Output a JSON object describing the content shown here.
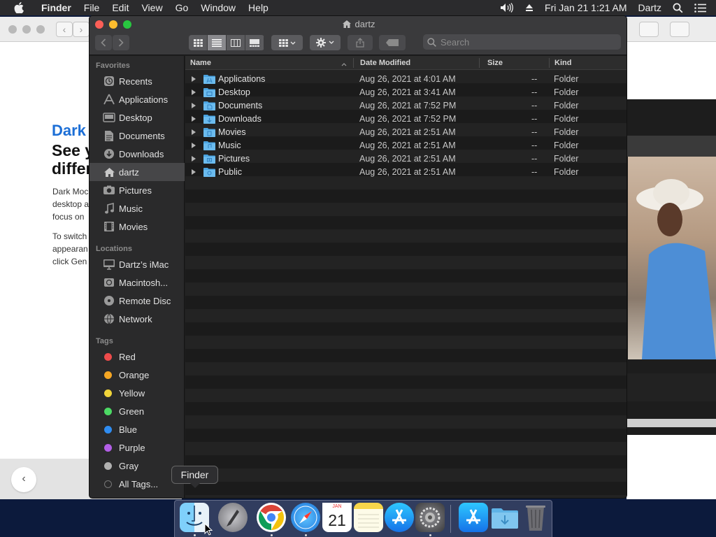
{
  "menubar": {
    "app_name": "Finder",
    "menus": [
      "File",
      "Edit",
      "View",
      "Go",
      "Window",
      "Help"
    ],
    "datetime": "Fri Jan 21  1:21 AM",
    "user": "Dartz"
  },
  "background_window": {
    "heading_blue": "Dark",
    "heading_line1": "See y",
    "heading_line2": "differ",
    "para1_lines": [
      "Dark Moc",
      "desktop a",
      "focus on"
    ],
    "para2_lines": [
      "To switch",
      "appearan",
      "click Gen"
    ],
    "back_label": "‹"
  },
  "finder": {
    "title": "dartz",
    "search_placeholder": "Search",
    "sidebar": {
      "favorites_header": "Favorites",
      "favorites": [
        {
          "label": "Recents",
          "icon": "clock-icon"
        },
        {
          "label": "Applications",
          "icon": "applications-icon"
        },
        {
          "label": "Desktop",
          "icon": "desktop-icon"
        },
        {
          "label": "Documents",
          "icon": "documents-icon"
        },
        {
          "label": "Downloads",
          "icon": "downloads-icon"
        },
        {
          "label": "dartz",
          "icon": "home-icon",
          "selected": true
        },
        {
          "label": "Pictures",
          "icon": "camera-icon"
        },
        {
          "label": "Music",
          "icon": "music-note-icon"
        },
        {
          "label": "Movies",
          "icon": "film-icon"
        }
      ],
      "locations_header": "Locations",
      "locations": [
        {
          "label": "Dartz’s iMac",
          "icon": "imac-icon"
        },
        {
          "label": "Macintosh...",
          "icon": "hard-drive-icon"
        },
        {
          "label": "Remote Disc",
          "icon": "disc-icon"
        },
        {
          "label": "Network",
          "icon": "globe-icon"
        }
      ],
      "tags_header": "Tags",
      "tags": [
        {
          "label": "Red",
          "color": "#ee4b4b"
        },
        {
          "label": "Orange",
          "color": "#f5a623"
        },
        {
          "label": "Yellow",
          "color": "#f0d43a"
        },
        {
          "label": "Green",
          "color": "#4cd964"
        },
        {
          "label": "Blue",
          "color": "#2f8cf0"
        },
        {
          "label": "Purple",
          "color": "#b25ee6"
        },
        {
          "label": "Gray",
          "color": "#b0b0b0"
        },
        {
          "label": "All Tags...",
          "color": "#555555"
        }
      ]
    },
    "columns": {
      "name": "Name",
      "date": "Date Modified",
      "size": "Size",
      "kind": "Kind"
    },
    "rows": [
      {
        "name": "Applications",
        "date": "Aug 26, 2021 at 4:01 AM",
        "size": "--",
        "kind": "Folder"
      },
      {
        "name": "Desktop",
        "date": "Aug 26, 2021 at 3:41 AM",
        "size": "--",
        "kind": "Folder"
      },
      {
        "name": "Documents",
        "date": "Aug 26, 2021 at 7:52 PM",
        "size": "--",
        "kind": "Folder"
      },
      {
        "name": "Downloads",
        "date": "Aug 26, 2021 at 7:52 PM",
        "size": "--",
        "kind": "Folder"
      },
      {
        "name": "Movies",
        "date": "Aug 26, 2021 at 2:51 AM",
        "size": "--",
        "kind": "Folder"
      },
      {
        "name": "Music",
        "date": "Aug 26, 2021 at 2:51 AM",
        "size": "--",
        "kind": "Folder"
      },
      {
        "name": "Pictures",
        "date": "Aug 26, 2021 at 2:51 AM",
        "size": "--",
        "kind": "Folder"
      },
      {
        "name": "Public",
        "date": "Aug 26, 2021 at 2:51 AM",
        "size": "--",
        "kind": "Folder"
      }
    ]
  },
  "dock": {
    "tooltip": "Finder",
    "calendar_month": "JAN",
    "calendar_day": "21",
    "apps": [
      "finder-icon",
      "launchpad-icon",
      "chrome-icon",
      "safari-icon",
      "calendar-icon",
      "notes-icon",
      "app-store-icon",
      "system-preferences-icon",
      "app-store-icon",
      "downloads-folder-icon",
      "trash-icon"
    ]
  },
  "colors": {
    "folder_blue": "#4aa3e0",
    "selection": "#464648",
    "accent_blue": "#1d6fd6"
  }
}
